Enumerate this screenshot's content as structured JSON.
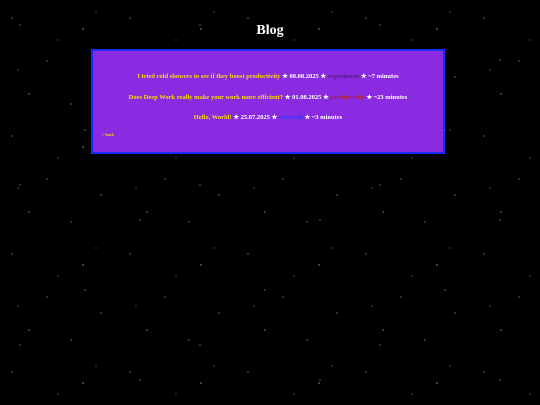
{
  "page": {
    "title": "Blog"
  },
  "posts": [
    {
      "title": "I tried cold showers to see if they boost productivity",
      "date": "08.08.2025",
      "tag": "experiment",
      "read_time": "~7 minutes"
    },
    {
      "title": "Does Deep Work really make your work more efficient?",
      "date": "01.08.2025",
      "tag": "productivity",
      "read_time": "~23 minutes"
    },
    {
      "title": "Hello, World!",
      "date": "25.07.2025",
      "tag": "personal",
      "read_time": "~3 minutes"
    }
  ],
  "separator": "★",
  "back_link": "<-back",
  "colors": {
    "background": "#000000",
    "panel": "#8a2be2",
    "panel_border": "#1a2dff",
    "title_link": "#ffd700",
    "tag_experiment": "#5a1a8a",
    "tag_productivity": "#b2223c",
    "tag_personal": "#2a3aff"
  }
}
